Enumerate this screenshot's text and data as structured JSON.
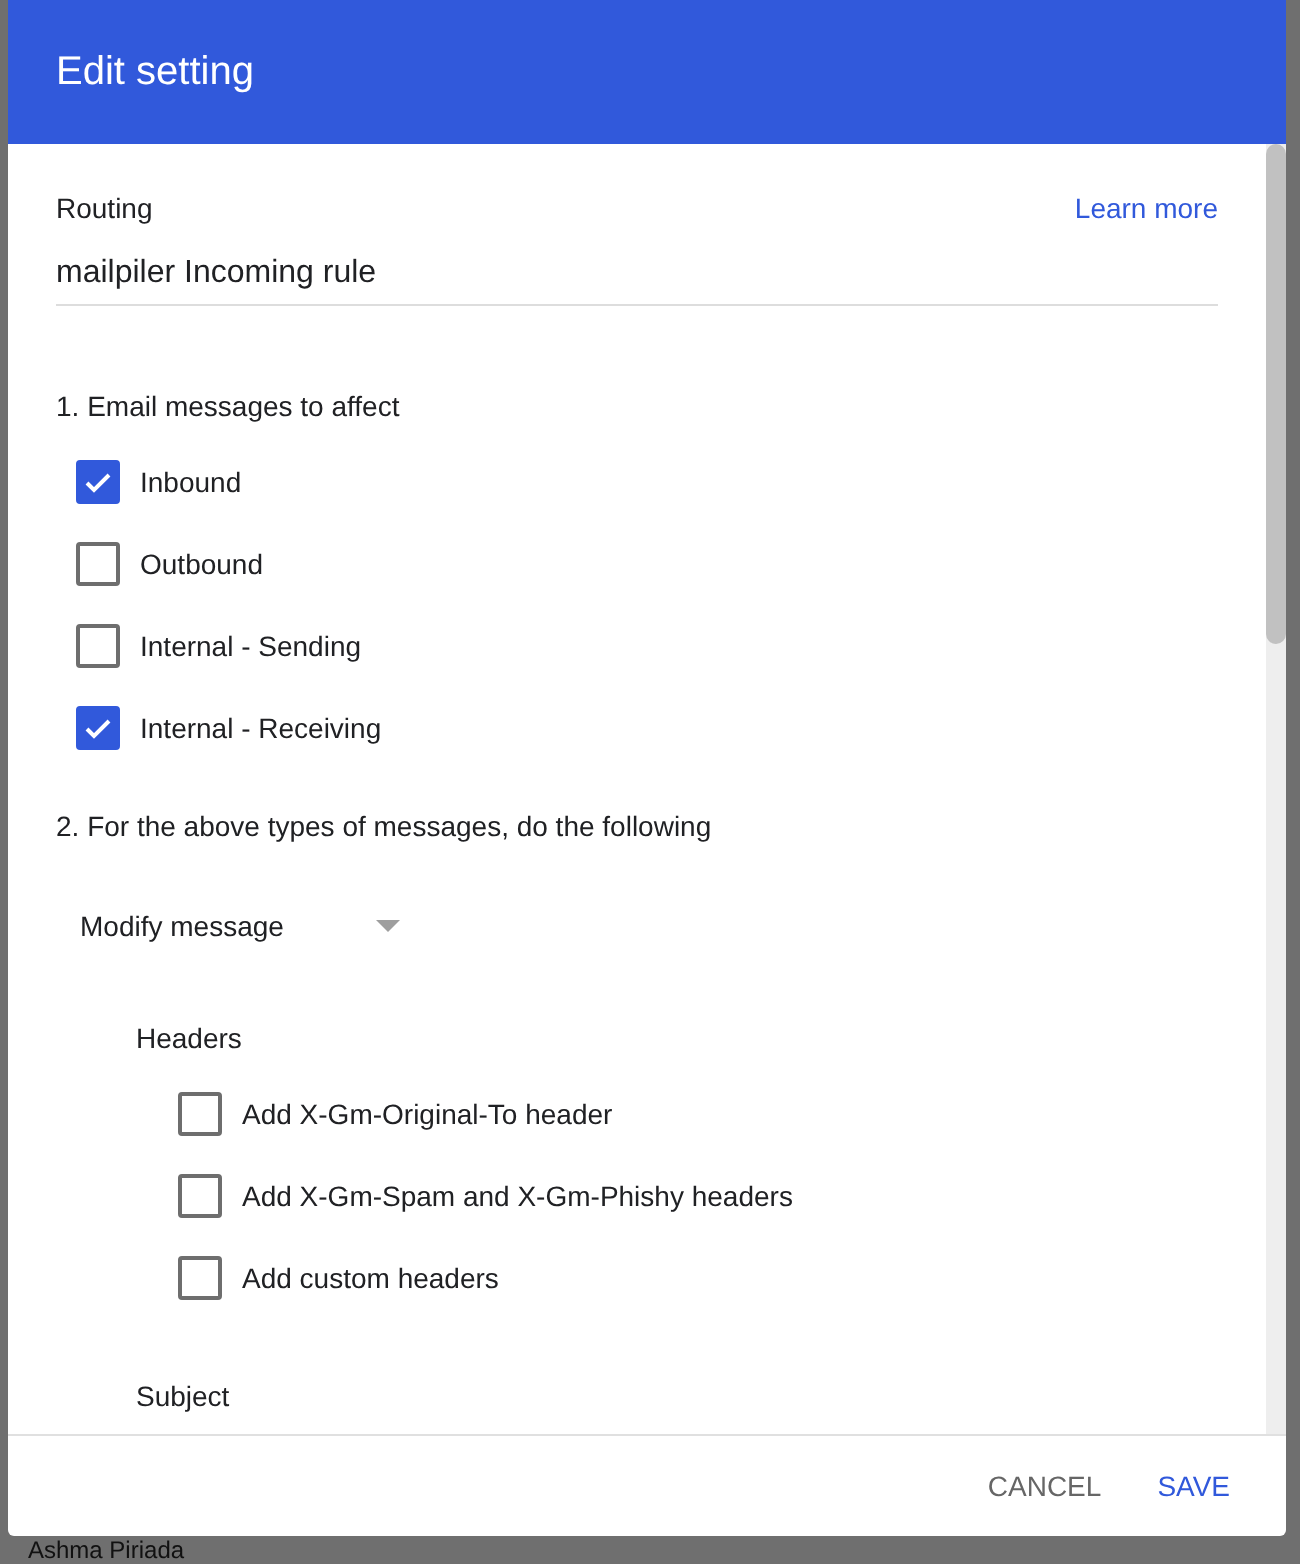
{
  "dialog": {
    "title": "Edit setting"
  },
  "routing": {
    "label": "Routing",
    "link": "Learn more",
    "value": "mailpiler Incoming rule"
  },
  "section_1": {
    "heading": "1. Email messages to affect",
    "options": [
      {
        "label": "Inbound",
        "checked": true
      },
      {
        "label": "Outbound",
        "checked": false
      },
      {
        "label": "Internal - Sending",
        "checked": false
      },
      {
        "label": "Internal - Receiving",
        "checked": true
      }
    ]
  },
  "section_2": {
    "heading": "2. For the above types of messages, do the following",
    "dropdown": {
      "value": "Modify message"
    },
    "groups": [
      {
        "heading": "Headers",
        "options": [
          {
            "label": "Add X-Gm-Original-To header",
            "checked": false
          },
          {
            "label": "Add X-Gm-Spam and X-Gm-Phishy headers",
            "checked": false
          },
          {
            "label": "Add custom headers",
            "checked": false
          }
        ]
      },
      {
        "heading": "Subject"
      }
    ]
  },
  "buttons": [
    {
      "label": "CANCEL",
      "kind": "secondary"
    },
    {
      "label": "SAVE",
      "kind": "primary"
    }
  ],
  "background": {
    "text": "Ashma Piriada"
  }
}
